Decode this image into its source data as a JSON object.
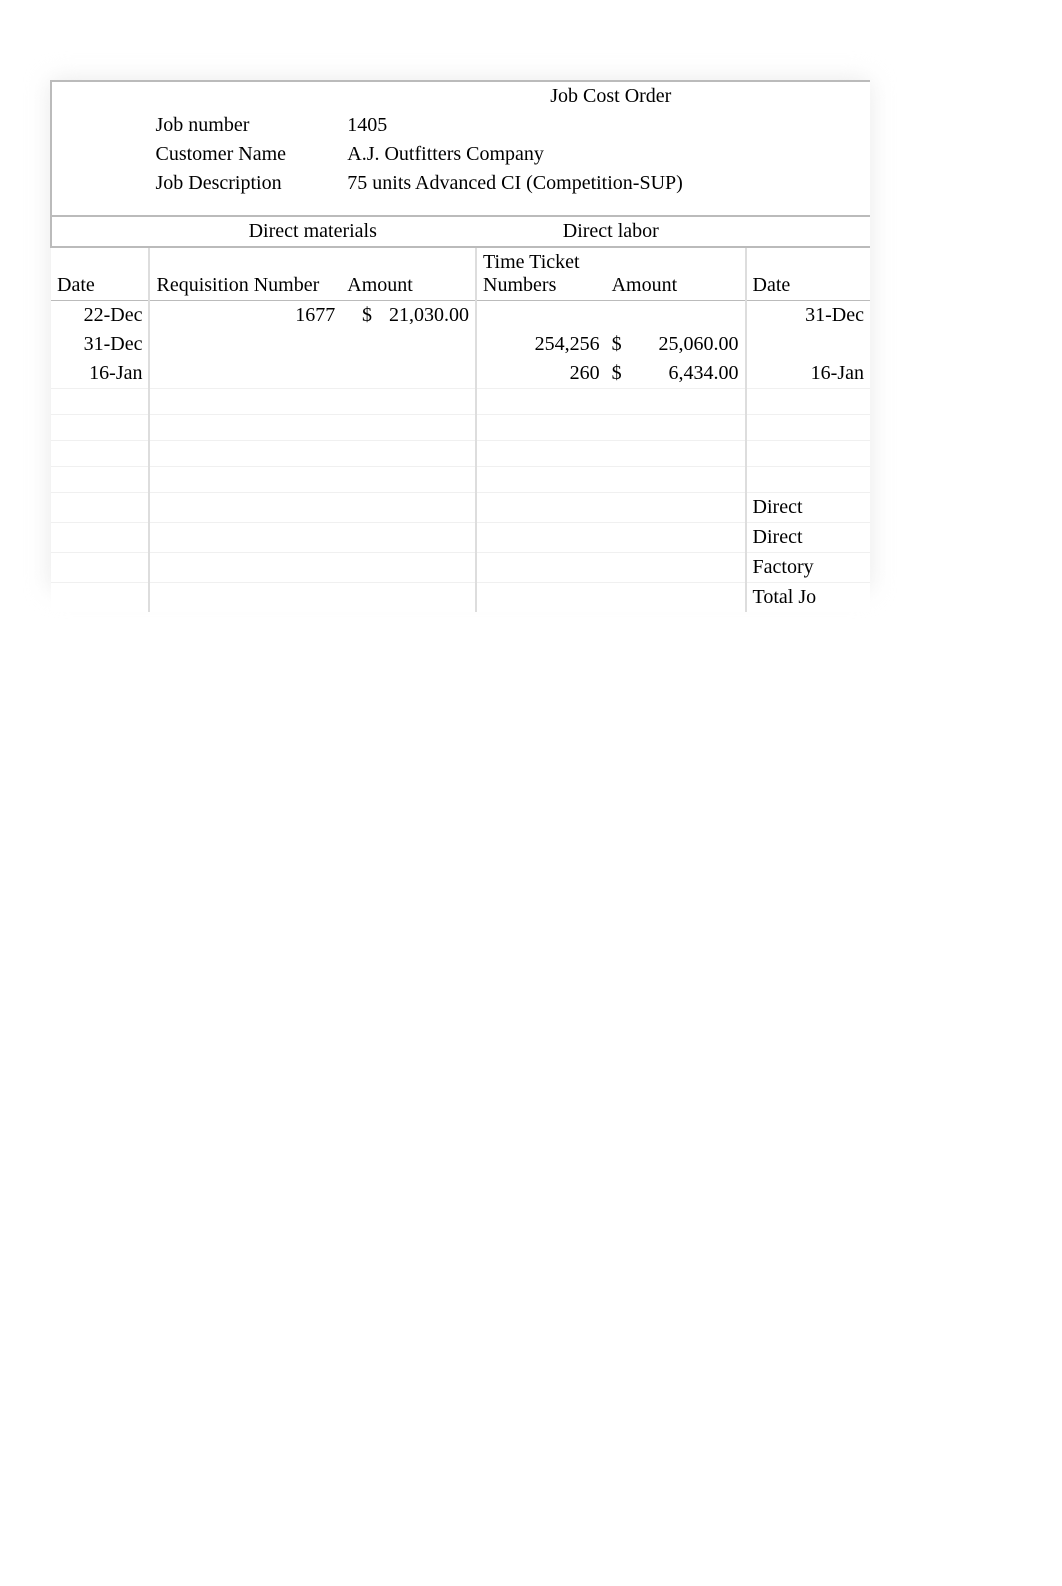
{
  "title": "Job Cost Order",
  "header": {
    "job_number_label": "Job number",
    "job_number": "1405",
    "customer_label": "Customer Name",
    "customer": "A.J. Outfitters Company",
    "description_label": "Job Description",
    "description": "75 units Advanced CI (Competition-SUP)"
  },
  "sections": {
    "direct_materials": "Direct materials",
    "direct_labor": "Direct labor"
  },
  "columns": {
    "date": "Date",
    "requisition_number": "Requisition Number",
    "amount": "Amount",
    "time_ticket_numbers": "Time Ticket Numbers",
    "amount2": "Amount",
    "date2": "Date"
  },
  "rows": [
    {
      "date": "22-Dec",
      "requisition_number": "1677",
      "dm_currency": "$",
      "dm_amount": "21,030.00",
      "ticket": "",
      "dl_currency": "",
      "dl_amount": "",
      "date2": "31-Dec"
    },
    {
      "date": "31-Dec",
      "requisition_number": "",
      "dm_currency": "",
      "dm_amount": "",
      "ticket": "254,256",
      "dl_currency": "$",
      "dl_amount": "25,060.00",
      "date2": ""
    },
    {
      "date": "16-Jan",
      "requisition_number": "",
      "dm_currency": "",
      "dm_amount": "",
      "ticket": "260",
      "dl_currency": "$",
      "dl_amount": "6,434.00",
      "date2": "16-Jan"
    }
  ],
  "summary": {
    "l1": "Direct",
    "l2": "Direct",
    "l3": "Factory",
    "l4": "Total Jo"
  }
}
